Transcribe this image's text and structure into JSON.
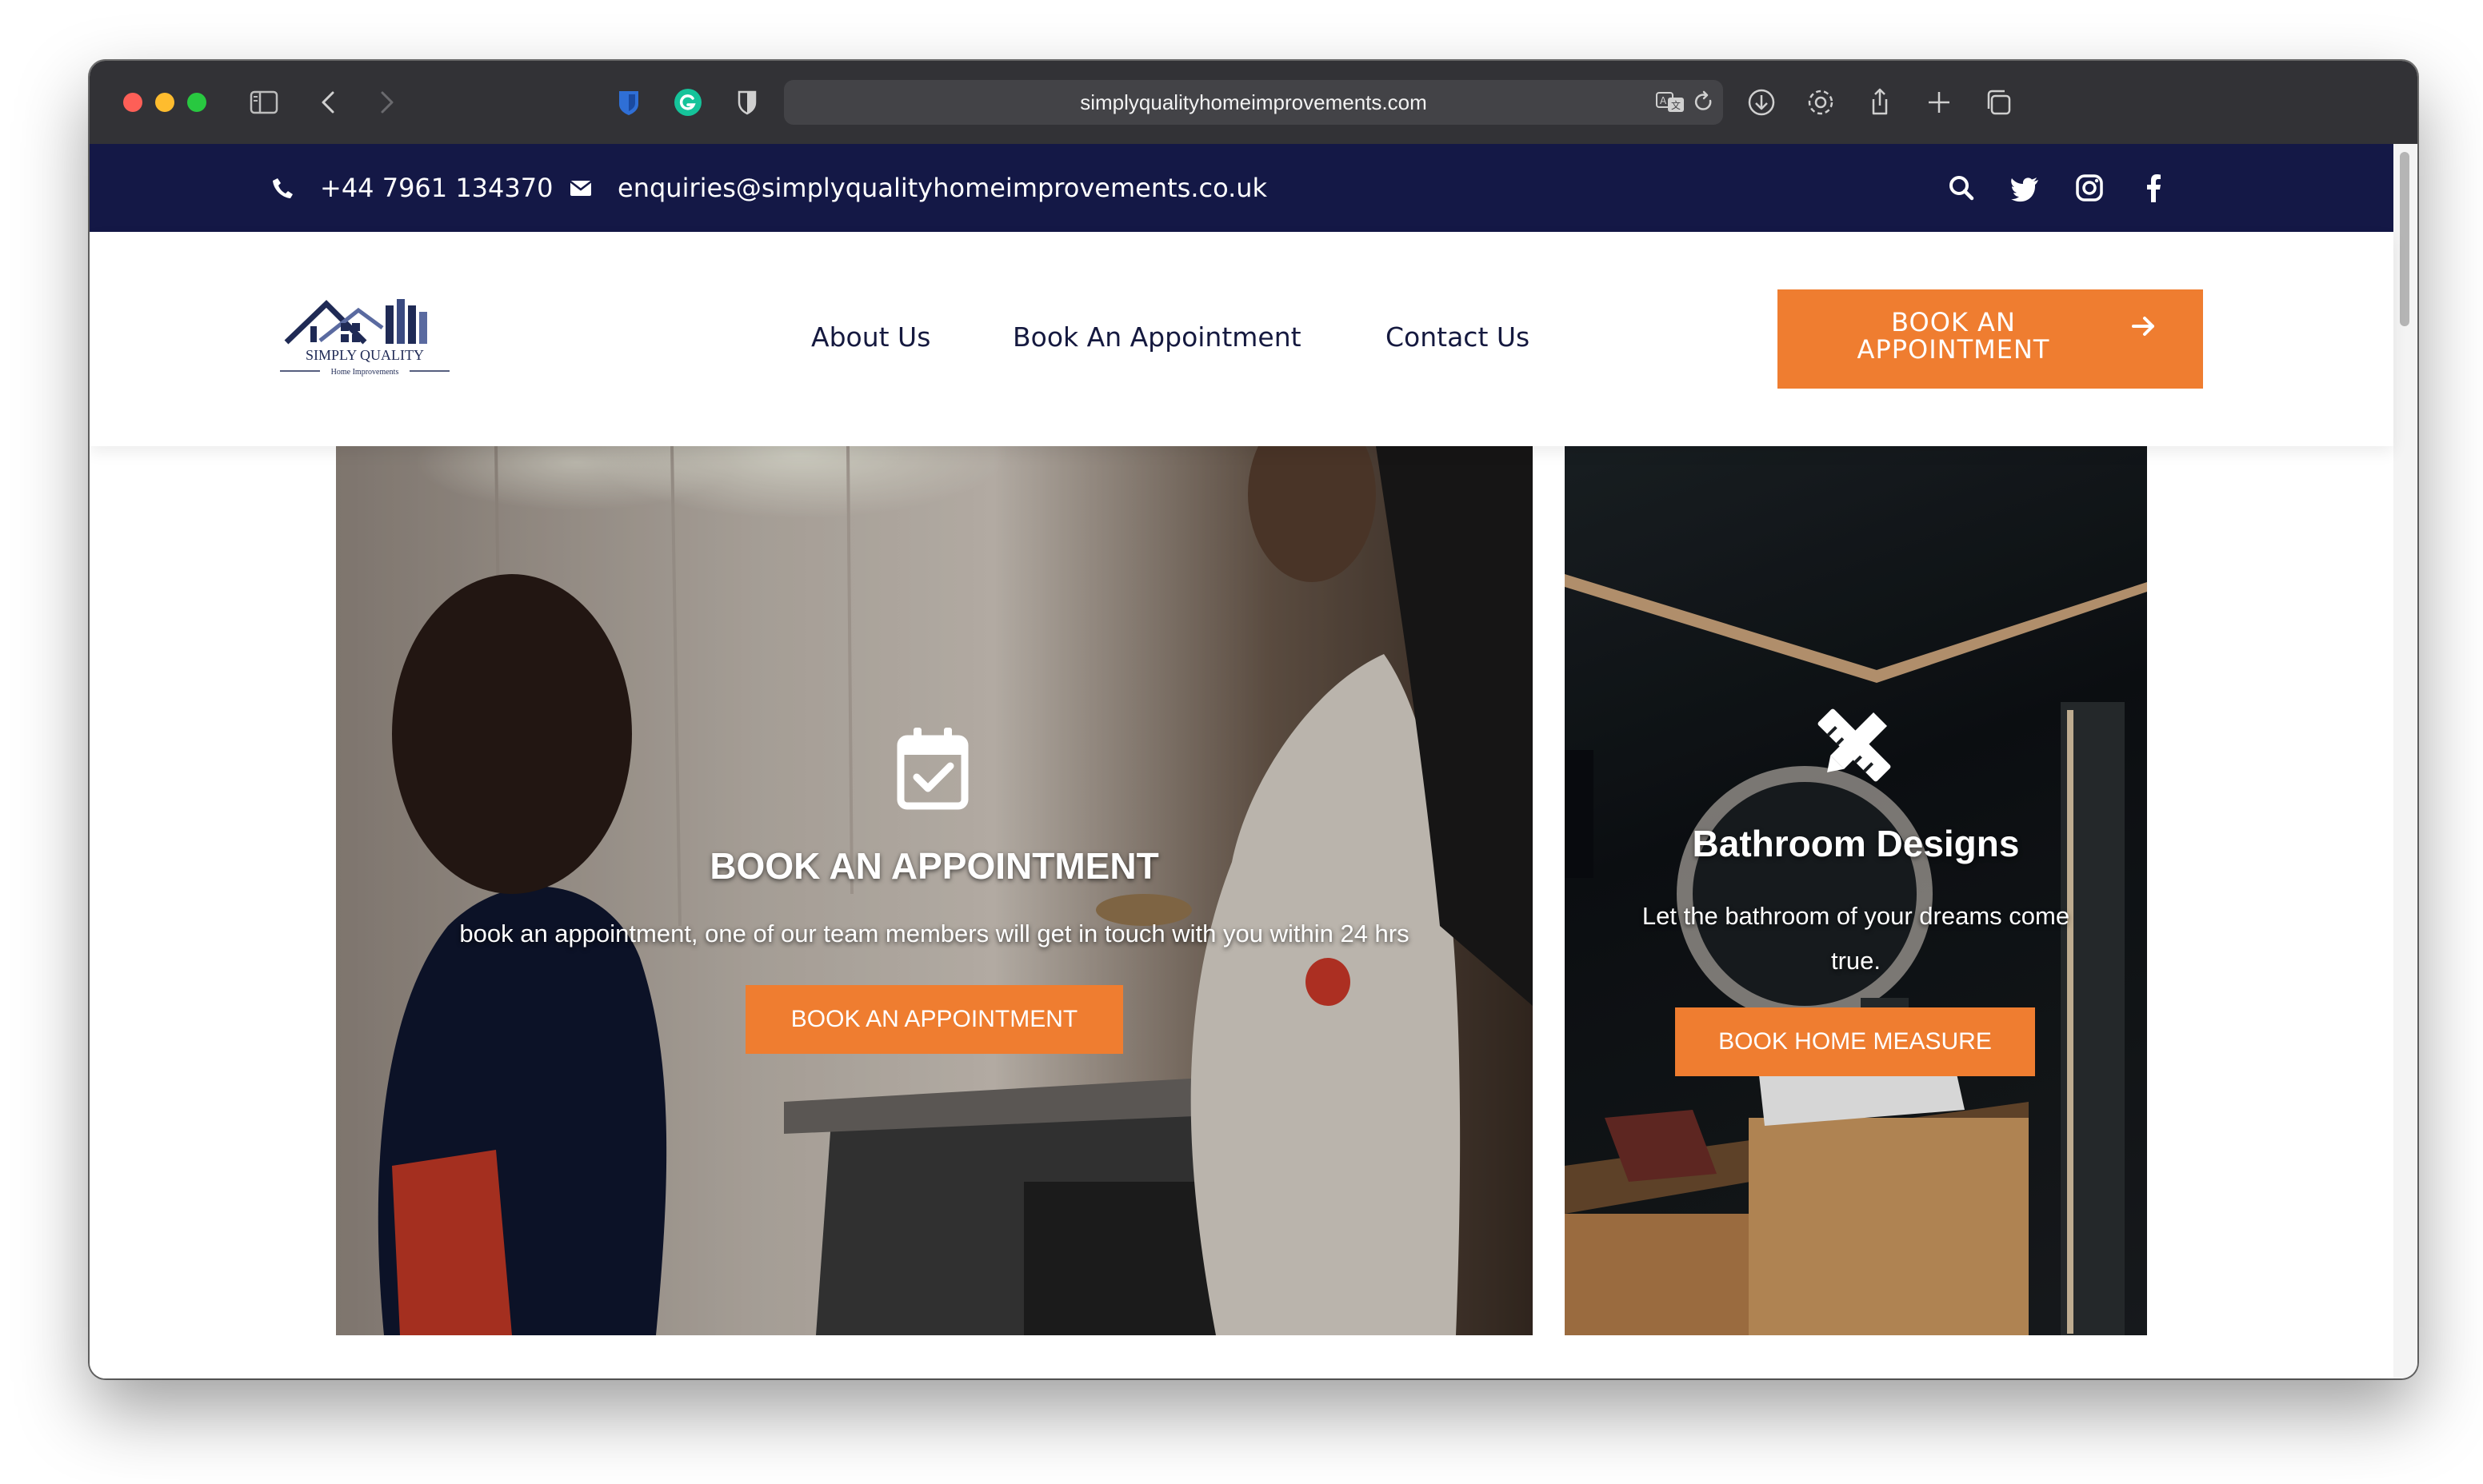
{
  "browser": {
    "url": "simplyqualityhomeimprovements.com",
    "icons": [
      "sidebar-icon",
      "back-icon",
      "forward-icon",
      "bitwarden-icon",
      "grammarly-icon",
      "privacy-shield-icon",
      "translate-icon",
      "reload-icon",
      "download-icon",
      "settings-icon",
      "share-icon",
      "new-tab-icon",
      "tabs-icon"
    ]
  },
  "topbar": {
    "phone": "+44 7961 134370",
    "email": "enquiries@simplyqualityhomeimprovements.co.uk",
    "icons": [
      "phone-icon",
      "envelope-icon",
      "search-icon",
      "twitter-icon",
      "instagram-icon",
      "facebook-icon"
    ]
  },
  "logo": {
    "line1": "SIMPLY QUALITY",
    "line2": "Home Improvements"
  },
  "nav": {
    "items": [
      {
        "label": "About Us"
      },
      {
        "label": "Book An Appointment"
      },
      {
        "label": "Contact Us"
      }
    ],
    "cta_line1": "BOOK AN",
    "cta_line2": "APPOINTMENT"
  },
  "panels": {
    "appointment": {
      "icon": "calendar-check-icon",
      "title": "BOOK AN APPOINTMENT",
      "text": "book an appointment, one of our team members will get in touch with you within 24 hrs",
      "button": "BOOK AN APPOINTMENT"
    },
    "bathroom": {
      "icon": "pencil-ruler-icon",
      "title": "Bathroom Designs",
      "text": "Let the bathroom of your dreams come true.",
      "button": "BOOK HOME MEASURE"
    }
  },
  "colors": {
    "topbar": "#141846",
    "accent": "#ef7d30",
    "nav_text": "#15193f"
  }
}
